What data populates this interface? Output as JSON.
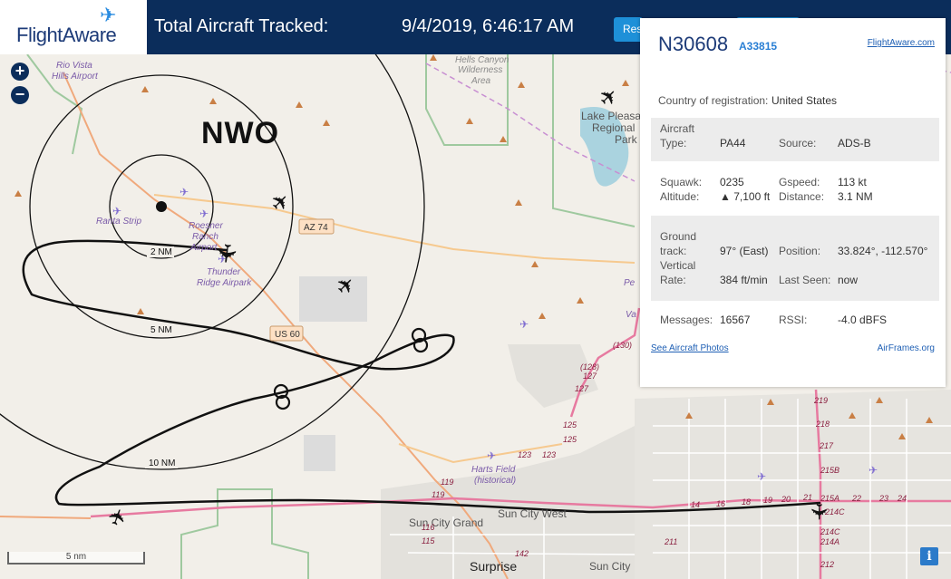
{
  "header": {
    "brand": "FlightAware",
    "total_label": "Total Aircraft Tracked:",
    "datetime": "9/4/2019, 6:46:17 AM",
    "reset_label": "Res"
  },
  "map": {
    "annotation": "NWO",
    "range_labels": {
      "r2": "2 NM",
      "r5": "5 NM",
      "r10": "10 NM"
    },
    "scale_label": "5 nm",
    "places": {
      "rio_vista": "Rio Vista",
      "rio_vista2": "Hills Airport",
      "hells_canyon": "Hells Canyon",
      "hells_canyon2": "Wilderness",
      "hells_canyon3": "Area",
      "lake_pleasant": "Lake Pleasant",
      "lake_pleasant2": "Regional",
      "lake_pleasant3": "Park",
      "ranta": "Ranta Strip",
      "roesner": "Roesner",
      "roesner2": "Ranch",
      "roesner3": "Airport",
      "thunder": "Thunder",
      "thunder2": "Ridge Airpark",
      "harts": "Harts Field",
      "harts2": "(historical)",
      "sun_city_grand": "Sun City Grand",
      "sun_city_west": "Sun City West",
      "surprise": "Surprise",
      "sun_city": "Sun City",
      "pv": "Pe",
      "pv2": "Va"
    },
    "shields": {
      "az74": "AZ 74",
      "us60": "US 60"
    },
    "road_labels": [
      "(130)",
      "(128)",
      "127",
      "127",
      "125",
      "125",
      "123",
      "123",
      "119",
      "119",
      "116",
      "115",
      "142",
      "219",
      "218",
      "217",
      "215B",
      "215A",
      "214C",
      "214C",
      "214A",
      "212",
      "211",
      "14",
      "16",
      "18",
      "19",
      "20",
      "21",
      "22",
      "23",
      "24",
      "26",
      "17"
    ]
  },
  "panel": {
    "tail": "N30608",
    "icao": "A33815",
    "fa_link": "FlightAware.com",
    "country_label": "Country of registration:",
    "country_value": "United States",
    "aircraft_label1": "Aircraft",
    "type_label": "Type:",
    "type_value": "PA44",
    "source_label": "Source:",
    "source_value": "ADS-B",
    "squawk_label": "Squawk:",
    "squawk_value": "0235",
    "gspeed_label": "Gspeed:",
    "gspeed_value": "113 kt",
    "altitude_label": "Altitude:",
    "altitude_value": "▲ 7,100 ft",
    "distance_label": "Distance:",
    "distance_value": "3.1 NM",
    "ground_label1": "Ground",
    "track_label": "track:",
    "track_value": "97° (East)",
    "position_label": "Position:",
    "position_value": "33.824°, -112.570°",
    "vertical_label1": "Vertical",
    "rate_label": "Rate:",
    "rate_value": "384 ft/min",
    "lastseen_label": "Last Seen:",
    "lastseen_value": "now",
    "messages_label": "Messages:",
    "messages_value": "16567",
    "rssi_label": "RSSI:",
    "rssi_value": "-4.0 dBFS",
    "photos_link": "See Aircraft Photos",
    "airframes_link": "AirFrames.org"
  },
  "controls": {
    "zoom_in": "+",
    "zoom_out": "−",
    "info": "i"
  },
  "colors": {
    "header": "#0b2d5b",
    "accent": "#1e90d8",
    "map_bg": "#f2efe9",
    "road_orange": "#f2b46b",
    "road_pink": "#e77aa0",
    "water": "#aad3df"
  }
}
